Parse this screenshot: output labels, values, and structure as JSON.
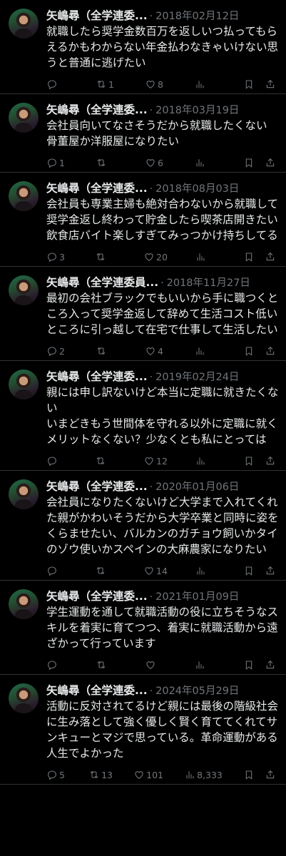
{
  "tweets": [
    {
      "name": "矢嶋尋（全学連委...",
      "date": "2018年02月12日",
      "text": "就職したら奨学金数百万を返しいつ払ってもらえるかもわからない年金払わなきゃいけない思うと普通に逃げたい",
      "replies": "",
      "retweets": "1",
      "likes": "8",
      "views": ""
    },
    {
      "name": "矢嶋尋（全学連委...",
      "date": "2018年03月19日",
      "text": "会社員向いてなさそうだから就職したくない 骨董屋か洋服屋になりたい",
      "replies": "1",
      "retweets": "",
      "likes": "6",
      "views": ""
    },
    {
      "name": "矢嶋尋（全学連委...",
      "date": "2018年08月03日",
      "text": "会社員も専業主婦も絶対合わないから就職して奨学金返し終わって貯金したら喫茶店開きたい 飲食店バイト楽しすぎてみっつかけ持ちしてる",
      "replies": "3",
      "retweets": "",
      "likes": "20",
      "views": ""
    },
    {
      "name": "矢嶋尋（全学連委員...",
      "date": "2018年11月27日",
      "text": "最初の会社ブラックでもいいから手に職つくところ入って奨学金返して辞めて生活コスト低いところに引っ越して在宅で仕事して生活したい",
      "replies": "2",
      "retweets": "",
      "likes": "4",
      "views": ""
    },
    {
      "name": "矢嶋尋（全学連委...",
      "date": "2019年02月24日",
      "text": "親には申し訳ないけど本当に定職に就きたくない\nいまどきもう世間体を守れる以外に定職に就くメリットなくない？少なくとも私にとっては",
      "replies": "",
      "retweets": "",
      "likes": "12",
      "views": ""
    },
    {
      "name": "矢嶋尋（全学連委...",
      "date": "2020年01月06日",
      "text": "会社員になりたくないけど大学まで入れてくれた親がかわいそうだから大学卒業と同時に姿をくらませたい、バルカンのガチョウ飼いかタイのゾウ使いかスペインの大麻農家になりたい",
      "replies": "",
      "retweets": "",
      "likes": "14",
      "views": ""
    },
    {
      "name": "矢嶋尋（全学連委...",
      "date": "2021年01月09日",
      "text": "学生運動を通して就職活動の役に立ちそうなスキルを着実に育てつつ、着実に就職活動から遠ざかって行っています",
      "replies": "",
      "retweets": "",
      "likes": "",
      "views": ""
    },
    {
      "name": "矢嶋尋（全学連委...",
      "date": "2024年05月29日",
      "text": "活動に反対されてるけど親には最後の階級社会に生み落として強く優しく賢く育ててくれてサンキューとマジで思っている。革命運動がある人生でよかった",
      "replies": "5",
      "retweets": "13",
      "likes": "101",
      "views": "8,333"
    }
  ],
  "icons": {
    "reply": "speech-bubble",
    "retweet": "retweet-arrows",
    "like": "heart",
    "views": "bar-chart",
    "bookmark": "bookmark",
    "share": "share"
  },
  "colors": {
    "background": "#000000",
    "text": "#e7e9ea",
    "muted": "#71767b",
    "divider": "#2f3336"
  }
}
